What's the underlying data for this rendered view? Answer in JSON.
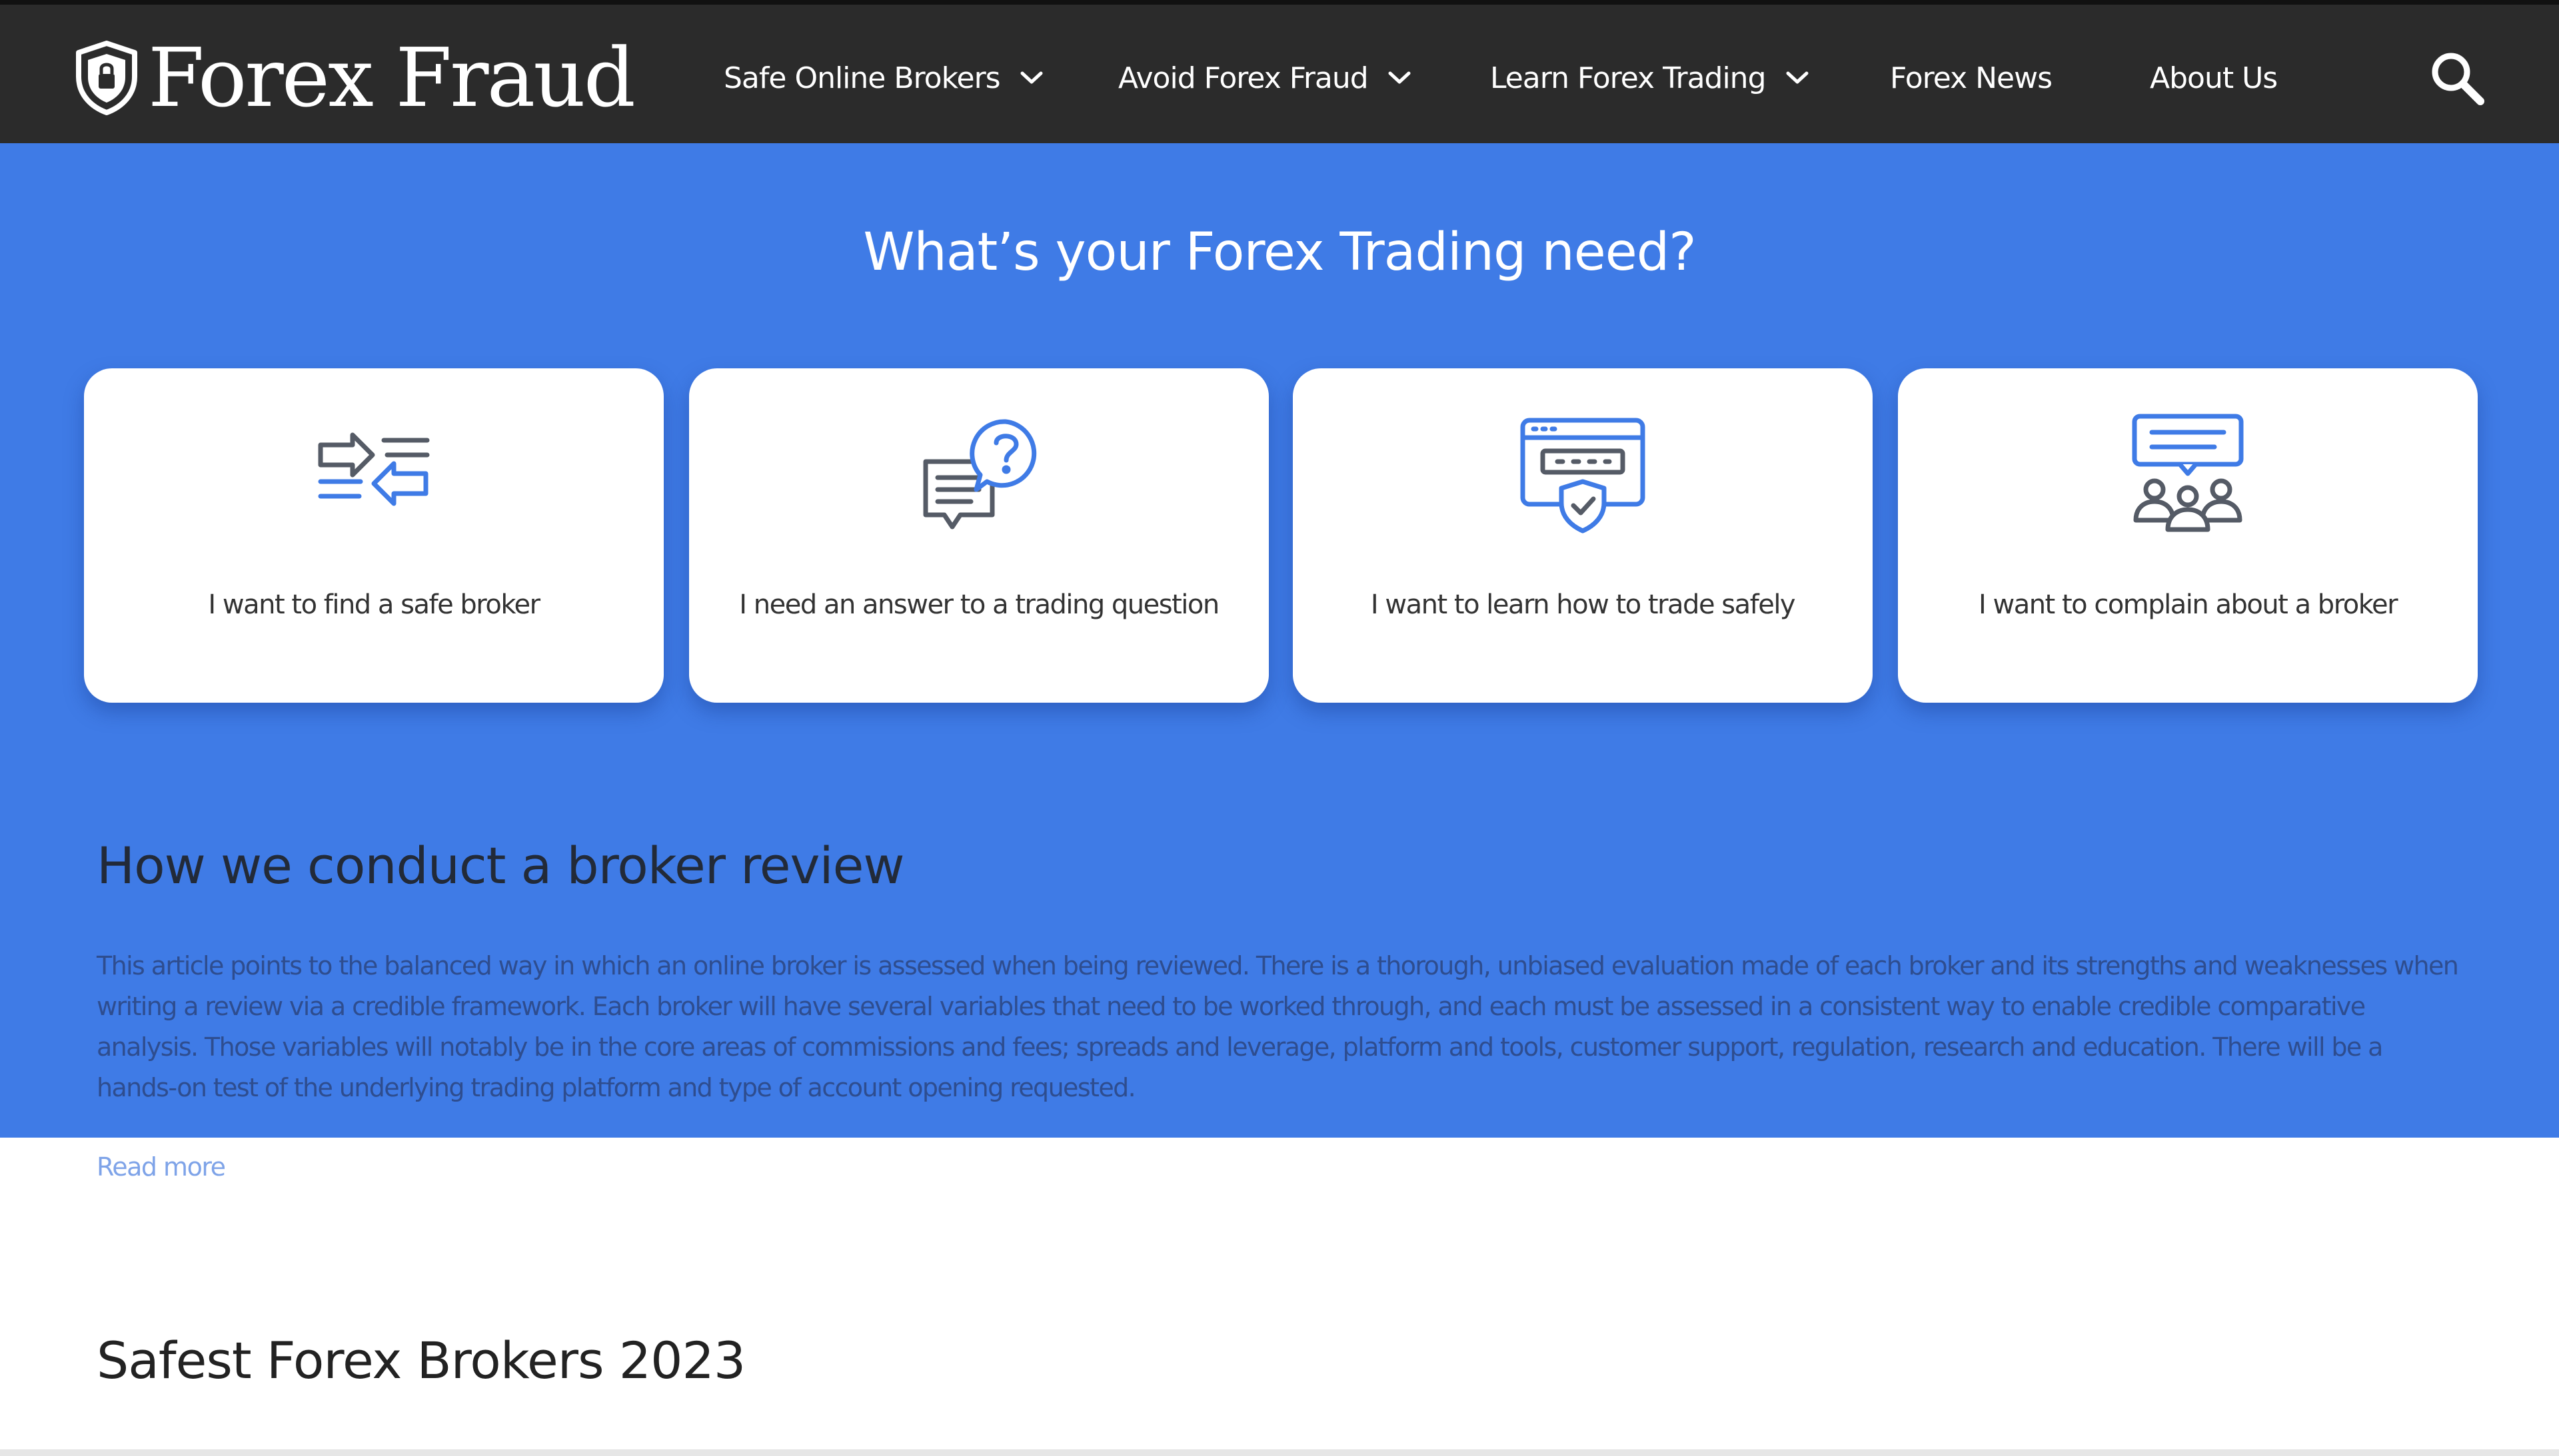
{
  "header": {
    "logo_text": "Forex Fraud",
    "nav": [
      {
        "label": "Safe Online Brokers",
        "has_dropdown": true
      },
      {
        "label": "Avoid Forex Fraud",
        "has_dropdown": true
      },
      {
        "label": "Learn Forex Trading",
        "has_dropdown": true
      },
      {
        "label": "Forex News",
        "has_dropdown": false
      },
      {
        "label": "About Us",
        "has_dropdown": false
      }
    ],
    "search_icon": "search-icon"
  },
  "hero": {
    "title": "What’s your Forex Trading need?",
    "cards": [
      {
        "label": "I want to find a safe broker",
        "icon": "transfer-arrows-icon"
      },
      {
        "label": "I need an answer to a trading question",
        "icon": "question-chat-icon"
      },
      {
        "label": "I want to learn how to trade safely",
        "icon": "secure-browser-icon"
      },
      {
        "label": "I want to complain about a broker",
        "icon": "group-discussion-icon"
      }
    ]
  },
  "review": {
    "heading": "How we conduct a broker review",
    "body": "This article points to the balanced way in which an online broker is assessed when being reviewed. There is a thorough, unbiased evaluation made of each broker and its strengths and weaknesses when writing a review via a credible framework. Each broker will have several variables that need to be worked through, and each must be assessed in a consistent way to enable credible comparative analysis. Those variables will notably be in the core areas of commissions and fees; spreads and leverage, platform and tools, customer support, regulation, research and education. There will be a hands-on test of the underlying trading platform and type of account opening requested.",
    "read_more": "Read more"
  },
  "safest_section": {
    "heading": "Safest Forex Brokers 2023"
  },
  "colors": {
    "nav_bg": "#2b2b2b",
    "hero_bg": "#3f7be6",
    "icon_blue": "#3f7be6",
    "icon_gray": "#555b66",
    "link": "#7ea3e8"
  }
}
